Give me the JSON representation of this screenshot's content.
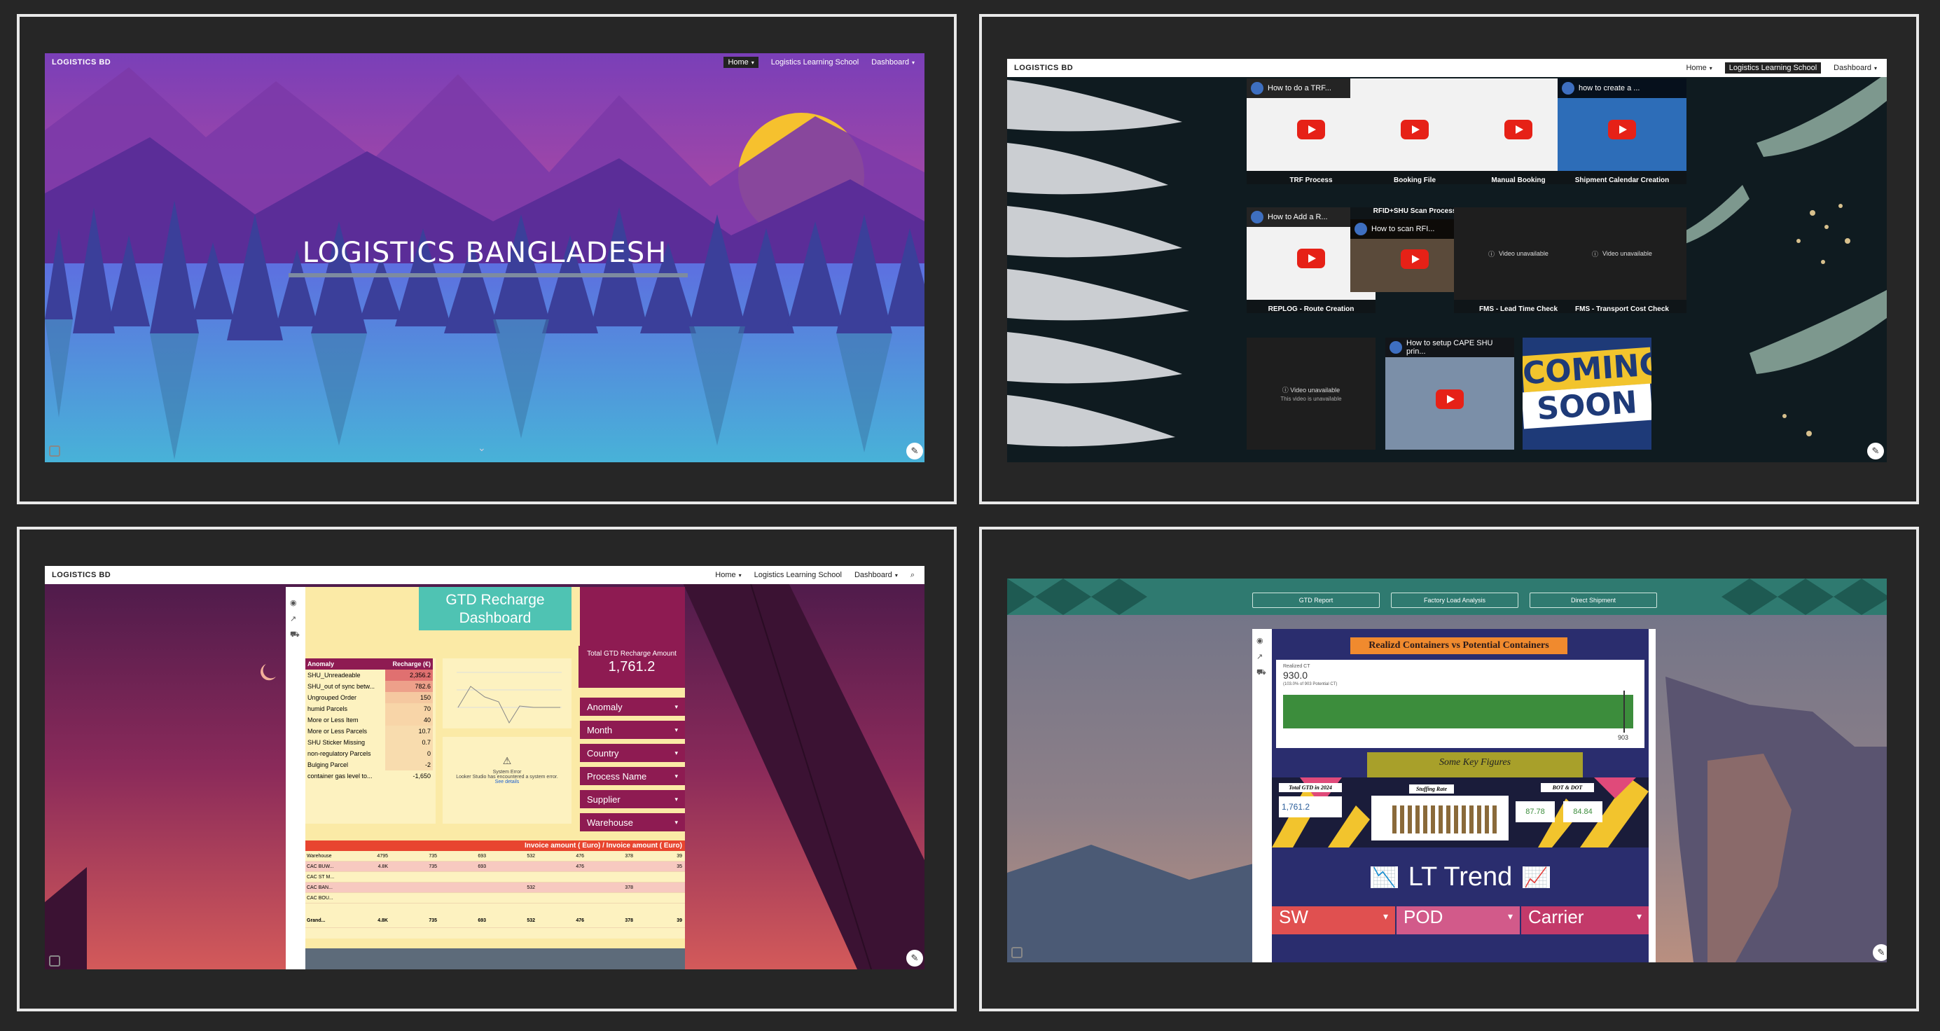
{
  "panel1": {
    "logo": "LOGISTICS BD",
    "nav": [
      "Home",
      "Logistics Learning School",
      "Dashboard"
    ],
    "hero_title": "LOGISTICS BANGLADESH"
  },
  "panel2": {
    "logo": "LOGISTICS BD",
    "nav": [
      "Home",
      "Logistics Learning School",
      "Dashboard"
    ],
    "videos": [
      {
        "title": "How to do a TRF...",
        "caption": "TRF Process",
        "type": "video"
      },
      {
        "title": "",
        "caption": "Booking File",
        "type": "video"
      },
      {
        "title": "",
        "caption": "Manual Booking",
        "type": "video"
      },
      {
        "title": "how to create a ...",
        "caption": "Shipment Calendar Creation",
        "type": "video"
      },
      {
        "title": "How to Add a R...",
        "caption": "REPLOG - Route Creation",
        "type": "video"
      },
      {
        "title": "How to scan RFI...",
        "caption": "RFID+SHU Scan Process",
        "type": "video"
      },
      {
        "title": "",
        "caption": "FMS - Lead Time Check",
        "type": "unavailable"
      },
      {
        "title": "",
        "caption": "FMS - Transport Cost Check",
        "type": "unavailable"
      },
      {
        "title": "",
        "caption": "",
        "type": "unavailable"
      },
      {
        "title": "How to setup CAPE SHU prin...",
        "caption": "",
        "type": "video"
      }
    ],
    "unavailable_text": "Video unavailable",
    "unavailable_sub": "This video is unavailable",
    "coming_soon": [
      "COMING",
      "SOON"
    ]
  },
  "panel3": {
    "logo": "LOGISTICS BD",
    "nav": [
      "Home",
      "Logistics Learning School",
      "Dashboard"
    ],
    "dashboard_title": "GTD Recharge Dashboard",
    "table_headers": [
      "Anomaly",
      "Recharge (€)"
    ],
    "anomalies": [
      {
        "name": "SHU_Unreadeable",
        "value": "2,356.2"
      },
      {
        "name": "SHU_out of sync betw...",
        "value": "782.6"
      },
      {
        "name": "Ungrouped Order",
        "value": "150"
      },
      {
        "name": "humid Parcels",
        "value": "70"
      },
      {
        "name": "More or Less Item",
        "value": "40"
      },
      {
        "name": "More or Less Parcels",
        "value": "10.7"
      },
      {
        "name": "SHU Sticker Missing",
        "value": "0.7"
      },
      {
        "name": "non-regulatory Parcels",
        "value": "0"
      },
      {
        "name": "Bulging Parcel",
        "value": "-2"
      },
      {
        "name": "container gas level to...",
        "value": "-1,650"
      }
    ],
    "kpi_label": "Total GTD Recharge Amount",
    "kpi_value": "1,761.2",
    "filters": [
      "Anomaly",
      "Month",
      "Country",
      "Process Name",
      "Supplier",
      "Warehouse"
    ],
    "error_title": "System Error",
    "error_text": "Looker Studio has encountered a system error.",
    "error_link": "See details",
    "invoice_header": "Invoice amount ( Euro) / Invoice amount ( Euro)",
    "invoice_rows": [
      {
        "label": "Warehouse",
        "v": [
          "4795",
          "735",
          "693",
          "532",
          "476",
          "378",
          "39"
        ]
      },
      {
        "label": "CAC BUW...",
        "v": [
          "4.8K",
          "735",
          "693",
          "",
          "476",
          "",
          "35"
        ]
      },
      {
        "label": "CAC ST M...",
        "v": [
          "",
          "",
          "",
          "",
          "",
          "",
          ""
        ]
      },
      {
        "label": "CAC BAN...",
        "v": [
          "",
          "",
          "",
          "532",
          "",
          "378",
          ""
        ]
      },
      {
        "label": "CAC BOU...",
        "v": [
          "",
          "",
          "",
          "",
          "",
          "",
          ""
        ]
      }
    ],
    "grand_total": {
      "label": "Grand...",
      "v": [
        "4.8K",
        "735",
        "693",
        "532",
        "476",
        "378",
        "39"
      ]
    }
  },
  "panel4": {
    "buttons": [
      "GTD Report",
      "Factory Load Analysis",
      "Direct Shipment"
    ],
    "realized_title": "Realizd Containers vs Potential Containers",
    "realized_caption": "Realized CT",
    "realized_value": "930.0",
    "realized_sub": "(103.0% of 903 Potential CT)",
    "potential_value": "903",
    "realized_fraction": 1.0,
    "key_figures": "Some Key Figures",
    "total_gtd_label": "Total GTD in 2024",
    "total_gtd_value": "1,761.2",
    "stuffing_label": "Stuffing Rate",
    "bot_label": "BOT & DOT",
    "bot_value": "87.78",
    "dot_value": "84.84",
    "lt_trend": "LT Trend",
    "filters": [
      "SW",
      "POD",
      "Carrier"
    ]
  },
  "colors": {
    "gtd_teal": "#4fc3b3",
    "maroon": "#8e1b52",
    "green_bar": "#3c8d3c",
    "navy": "#2a2d6e",
    "gold": "#a8a02a"
  }
}
